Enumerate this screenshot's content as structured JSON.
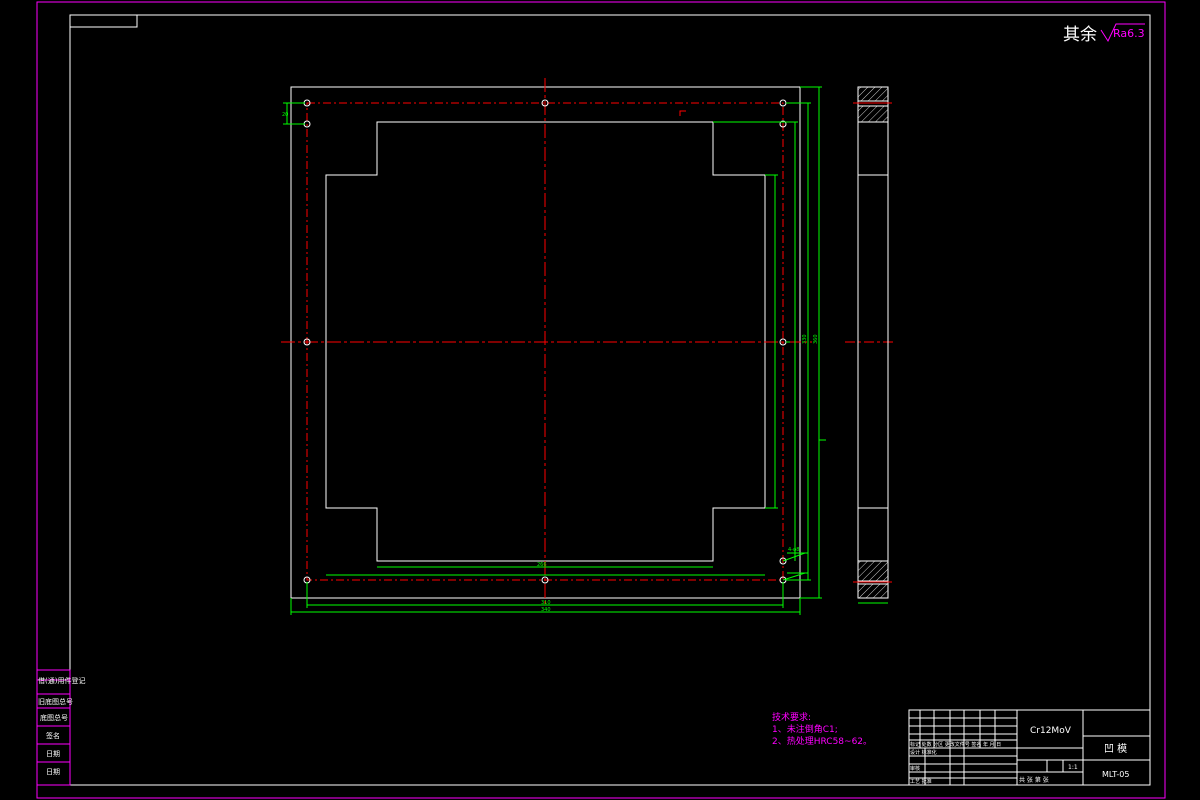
{
  "colors": {
    "background": "#000000",
    "frame": "#ff00ff",
    "outline": "#ffffff",
    "dimension": "#00ff00",
    "centerline": "#ff0000",
    "notes": "#ff00ff",
    "material": "#ffffff"
  },
  "roughness": {
    "prefix": "其余",
    "value": "Ra6.3"
  },
  "tech_notes": {
    "heading": "技术要求:",
    "line1": "1、未注倒角C1;",
    "line2": "2、热处理HRC58~62。"
  },
  "title_block": {
    "material": "Cr12MoV",
    "part_name": "凹 模",
    "drawing_no": "MLT-05",
    "scale": "1:1",
    "sheet_info": "共 张  第 张",
    "rows": [
      "标记 处数 分区 更改文件号 签名 年 月 日",
      "设计  标准化",
      "审核",
      "工艺  批准"
    ]
  },
  "side_stamp": {
    "rows": [
      "借(通)用件登记",
      "旧底图总号",
      "底图总号",
      "签名",
      "日期",
      "日期"
    ]
  },
  "dims": {
    "bottom_inner": "310",
    "bottom_outer": "340",
    "right_inner": "330",
    "right_outer": "360",
    "left_small": "20",
    "bottom_small": "266",
    "hole_note": "4-φ8"
  }
}
